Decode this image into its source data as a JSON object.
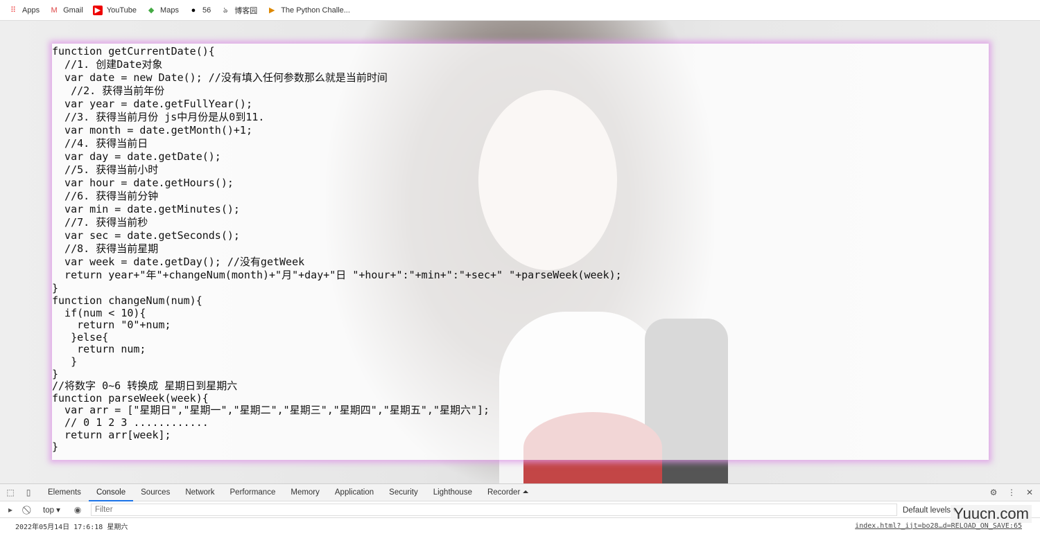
{
  "bookmarks": [
    {
      "label": "Apps",
      "icon": "apps-grid-icon"
    },
    {
      "label": "Gmail",
      "icon": "gmail-icon"
    },
    {
      "label": "YouTube",
      "icon": "youtube-icon"
    },
    {
      "label": "Maps",
      "icon": "maps-icon"
    },
    {
      "label": "56",
      "icon": "56-icon"
    },
    {
      "label": "博客园",
      "icon": "cnblogs-icon"
    },
    {
      "label": "The Python Challe...",
      "icon": "python-challenge-icon"
    }
  ],
  "code_lines_a": [
    "function getCurrentDate(){",
    "  //1. 创建Date对象",
    "  var date = new Date(); //没有填入任何参数那么就是当前时间",
    "   //2. 获得当前年份",
    "  var year = date.getFullYear();",
    "  //3. 获得当前月份 js中月份是从0到11.",
    "  var month = date.getMonth()+1;",
    "  //4. 获得当前日",
    "  var day = date.getDate();",
    "  //5. 获得当前小时",
    "  var hour = date.getHours();",
    "  //6. 获得当前分钟",
    "  var min = date.getMinutes();",
    "  //7. 获得当前秒",
    "  var sec = date.getSeconds();",
    "  //8. 获得当前星期",
    "  var week = date.getDay(); //没有getWeek",
    "  return year+\"年\"+changeNum(month)+\"月\"+day+\"日 \"+hour+\":\"+min+\":\"+sec+\" \"+parseWeek(week);",
    "}"
  ],
  "code_lines_b": [
    "function changeNum(num){",
    "  if(num < 10){",
    "    return \"0\"+num;",
    "   }else{",
    "    return num;",
    "   }",
    "}",
    "//将数字 0~6 转换成 星期日到星期六",
    "function parseWeek(week){",
    "  var arr = [\"星期日\",\"星期一\",\"星期二\",\"星期三\",\"星期四\",\"星期五\",\"星期六\"];",
    "  // 0 1 2 3 ............",
    "  return arr[week];",
    "}"
  ],
  "devtools": {
    "tabs": [
      "Elements",
      "Console",
      "Sources",
      "Network",
      "Performance",
      "Memory",
      "Application",
      "Security",
      "Lighthouse",
      "Recorder ⏶"
    ],
    "active_tab": "Console",
    "context": "top ▾",
    "filter_placeholder": "Filter",
    "levels": "Default levels ▾",
    "log_message": "2022年05月14日 17:6:18 星期六",
    "log_source": "index.html?_ijt=bo28…d=RELOAD_ON_SAVE:65"
  },
  "watermark": "Yuucn.com"
}
